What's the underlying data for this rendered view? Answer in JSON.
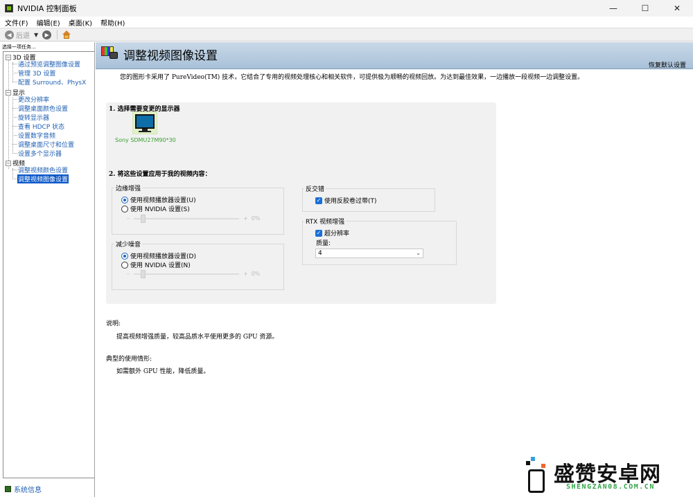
{
  "window": {
    "title": "NVIDIA 控制面板",
    "controls": [
      "—",
      "☐",
      "✕"
    ]
  },
  "menu": [
    "文件(F)",
    "编辑(E)",
    "桌面(K)",
    "帮助(H)"
  ],
  "toolbar": {
    "back_label": "后退"
  },
  "left_pane": {
    "header": "选择一项任务...",
    "categories": [
      {
        "label": "3D 设置",
        "items": [
          "通过预览调整图像设置",
          "管理 3D 设置",
          "配置 Surround、PhysX"
        ]
      },
      {
        "label": "显示",
        "items": [
          "更改分辨率",
          "调整桌面颜色设置",
          "旋转显示器",
          "查看 HDCP 状态",
          "设置数字音频",
          "调整桌面尺寸和位置",
          "设置多个显示器"
        ]
      },
      {
        "label": "视频",
        "items": [
          "调整视频颜色设置",
          "调整视频图像设置"
        ]
      }
    ],
    "selected": "调整视频图像设置",
    "system_info": "系统信息"
  },
  "page": {
    "title": "调整视频图像设置",
    "restore_defaults": "恢复默认设置",
    "description": "您的图形卡采用了 PureVideo(TM) 技术，它结合了专用的视频处理核心和相关软件，可提供极为顺畅的视频回放。为达到最佳效果，一边播放一段视频一边调整设置。",
    "section1": {
      "title": "1. 选择需要变更的显示器",
      "monitor": "Sony SDMU27M90*30"
    },
    "section2": {
      "title": "2. 将这些设置应用于我的视频内容：",
      "edge": {
        "label": "边缘增强",
        "opt1": "使用视频播放器设置(U)",
        "opt2": "使用 NVIDIA 设置(S)",
        "min": "–",
        "max": "+",
        "value": "0%"
      },
      "noise": {
        "label": "减少噪音",
        "opt1": "使用视频播放器设置(D)",
        "opt2": "使用 NVIDIA 设置(N)",
        "min": "–",
        "max": "+",
        "value": "0%"
      },
      "deinterlace": {
        "label": "反交错",
        "checkbox": "使用反胶卷过带(T)",
        "checked": true
      },
      "rtx": {
        "label": "RTX 视频增强",
        "checkbox": "超分辨率",
        "checked": true,
        "quality_label": "质量:",
        "quality_value": "4"
      }
    },
    "notes": {
      "desc_label": "说明:",
      "desc_text": "提高视频增强质量，较高品质水平使用更多的 GPU 资源。",
      "usage_label": "典型的使用情形:",
      "usage_text": "如需额外 GPU 性能，降低质量。"
    }
  },
  "watermark": {
    "title": "盛赞安卓网",
    "subtitle": "SHENGZAN08.COM.CN"
  }
}
